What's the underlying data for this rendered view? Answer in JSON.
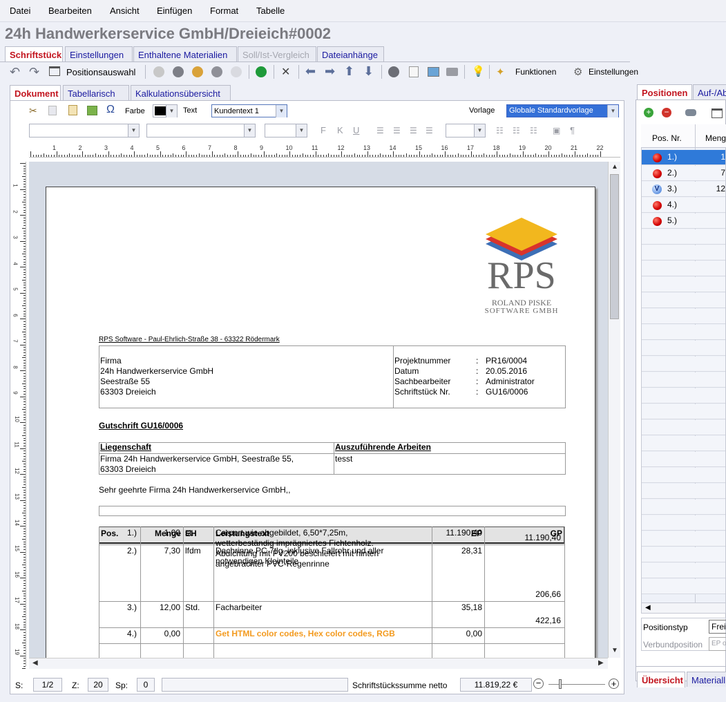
{
  "menu": [
    "Datei",
    "Bearbeiten",
    "Ansicht",
    "Einfügen",
    "Format",
    "Tabelle"
  ],
  "window_title": "24h Handwerkerservice GmbH/Dreieich#0002",
  "main_tabs": [
    "Schriftstück",
    "Einstellungen",
    "Enthaltene Materialien",
    "Soll/Ist-Vergleich",
    "Dateianhänge"
  ],
  "toolbar": {
    "positionsauswahl": "Positionsauswahl",
    "funktionen": "Funktionen",
    "einstellungen": "Einstellungen"
  },
  "doc_tabs": [
    "Dokument",
    "Tabellarisch",
    "Kalkulationsübersicht"
  ],
  "format_bar": {
    "farbe_label": "Farbe",
    "text_label": "Text",
    "text_style": "Kundentext 1",
    "vorlage_label": "Vorlage",
    "vorlage_value": "Globale Standardvorlage"
  },
  "format_buttons": [
    "F",
    "K",
    "U"
  ],
  "ruler_numbers": [
    "1",
    "2",
    "3",
    "4",
    "5",
    "6",
    "7",
    "8",
    "9",
    "10",
    "11",
    "12",
    "13",
    "14",
    "15",
    "16",
    "17",
    "18",
    "19",
    "20",
    "21",
    "22"
  ],
  "vruler_numbers": [
    "1",
    "2",
    "3",
    "4",
    "5",
    "6",
    "7",
    "8",
    "9",
    "10",
    "11",
    "12",
    "13",
    "14",
    "15",
    "16",
    "17",
    "18",
    "19"
  ],
  "logo": {
    "text": "RPS",
    "line1": "ROLAND PISKE",
    "line2": "SOFTWARE GMBH",
    "colors": [
      "#f2b71e",
      "#d9342b",
      "#3d6fb6"
    ]
  },
  "sender_line": "RPS Software - Paul-Ehrlich-Straße 38 - 63322 Rödermark",
  "address": [
    "Firma",
    "24h Handwerkerservice GmbH",
    "Seestraße 55",
    "63303 Dreieich"
  ],
  "meta": [
    {
      "label": "Projektnummer",
      "value": "PR16/0004"
    },
    {
      "label": "Datum",
      "value": "20.05.2016"
    },
    {
      "label": "Sachbearbeiter",
      "value": "Administrator"
    },
    {
      "label": "Schriftstück Nr.",
      "value": "GU16/0006"
    }
  ],
  "doc_heading": "Gutschrift GU16/0006",
  "property": {
    "h1": "Liegenschaft",
    "h2": "Auszuführende Arbeiten",
    "v1a": "Firma 24h Handwerkerservice GmbH, Seestraße 55,",
    "v1b": "63303 Dreieich",
    "v2": "tesst"
  },
  "greeting": "Sehr geehrte Firma 24h Handwerkerservice GmbH,,",
  "table": {
    "headers": [
      "Pos.",
      "Menge",
      "EH",
      "Leistungstext",
      "EP",
      "GP"
    ],
    "rows": [
      {
        "pos": "1.)",
        "menge": "1,00",
        "eh": "st.",
        "text": [
          "Carport wie abgebildet, 6,50*7,25m,",
          "wetterbeständig imprägniertes Fichtenholz.",
          "Abdichtung mit PV200 beschiefert mit hinten",
          "angebrachter PVC-Regenrinne"
        ],
        "ep": "11.190,40",
        "gp": "11.190,40"
      },
      {
        "pos": "2.)",
        "menge": "7,30",
        "eh": "lfdm",
        "text": [
          "Dachrinne PC 7tlg. inklusive Fallrohr und aller",
          "notwendigen Kleinteile"
        ],
        "ep": "28,31",
        "gp": "206,66"
      },
      {
        "pos": "3.)",
        "menge": "12,00",
        "eh": "Std.",
        "text": [
          "Facharbeiter"
        ],
        "ep": "35,18",
        "gp": "422,16"
      },
      {
        "pos": "4.)",
        "menge": "0,00",
        "eh": "",
        "text": [
          "Get HTML color codes, Hex color codes, RGB"
        ],
        "ep": "0,00",
        "gp": ""
      }
    ],
    "highlight_color": "#f39a1e"
  },
  "status": {
    "s_label": "S:",
    "s_value": "1/2",
    "z_label": "Z:",
    "z_value": "20",
    "sp_label": "Sp:",
    "sp_value": "0",
    "sum_label": "Schriftstückssumme netto",
    "sum_value": "11.819,22 €"
  },
  "right": {
    "tabs": [
      "Positionen",
      "Auf-/Ab"
    ],
    "headers": [
      "Pos. Nr.",
      "Meng"
    ],
    "rows": [
      {
        "pos": "1.)",
        "menge": "1",
        "type": "red"
      },
      {
        "pos": "2.)",
        "menge": "7",
        "type": "red"
      },
      {
        "pos": "3.)",
        "menge": "12",
        "type": "v"
      },
      {
        "pos": "4.)",
        "menge": "",
        "type": "red"
      },
      {
        "pos": "5.)",
        "menge": "",
        "type": "red"
      }
    ],
    "v_letter": "V",
    "props": [
      {
        "label": "Positionstyp",
        "value": "Frei"
      },
      {
        "label": "Verbundposition",
        "value": "EP o"
      }
    ],
    "bottom_tabs": [
      "Übersicht",
      "Materiall"
    ]
  }
}
